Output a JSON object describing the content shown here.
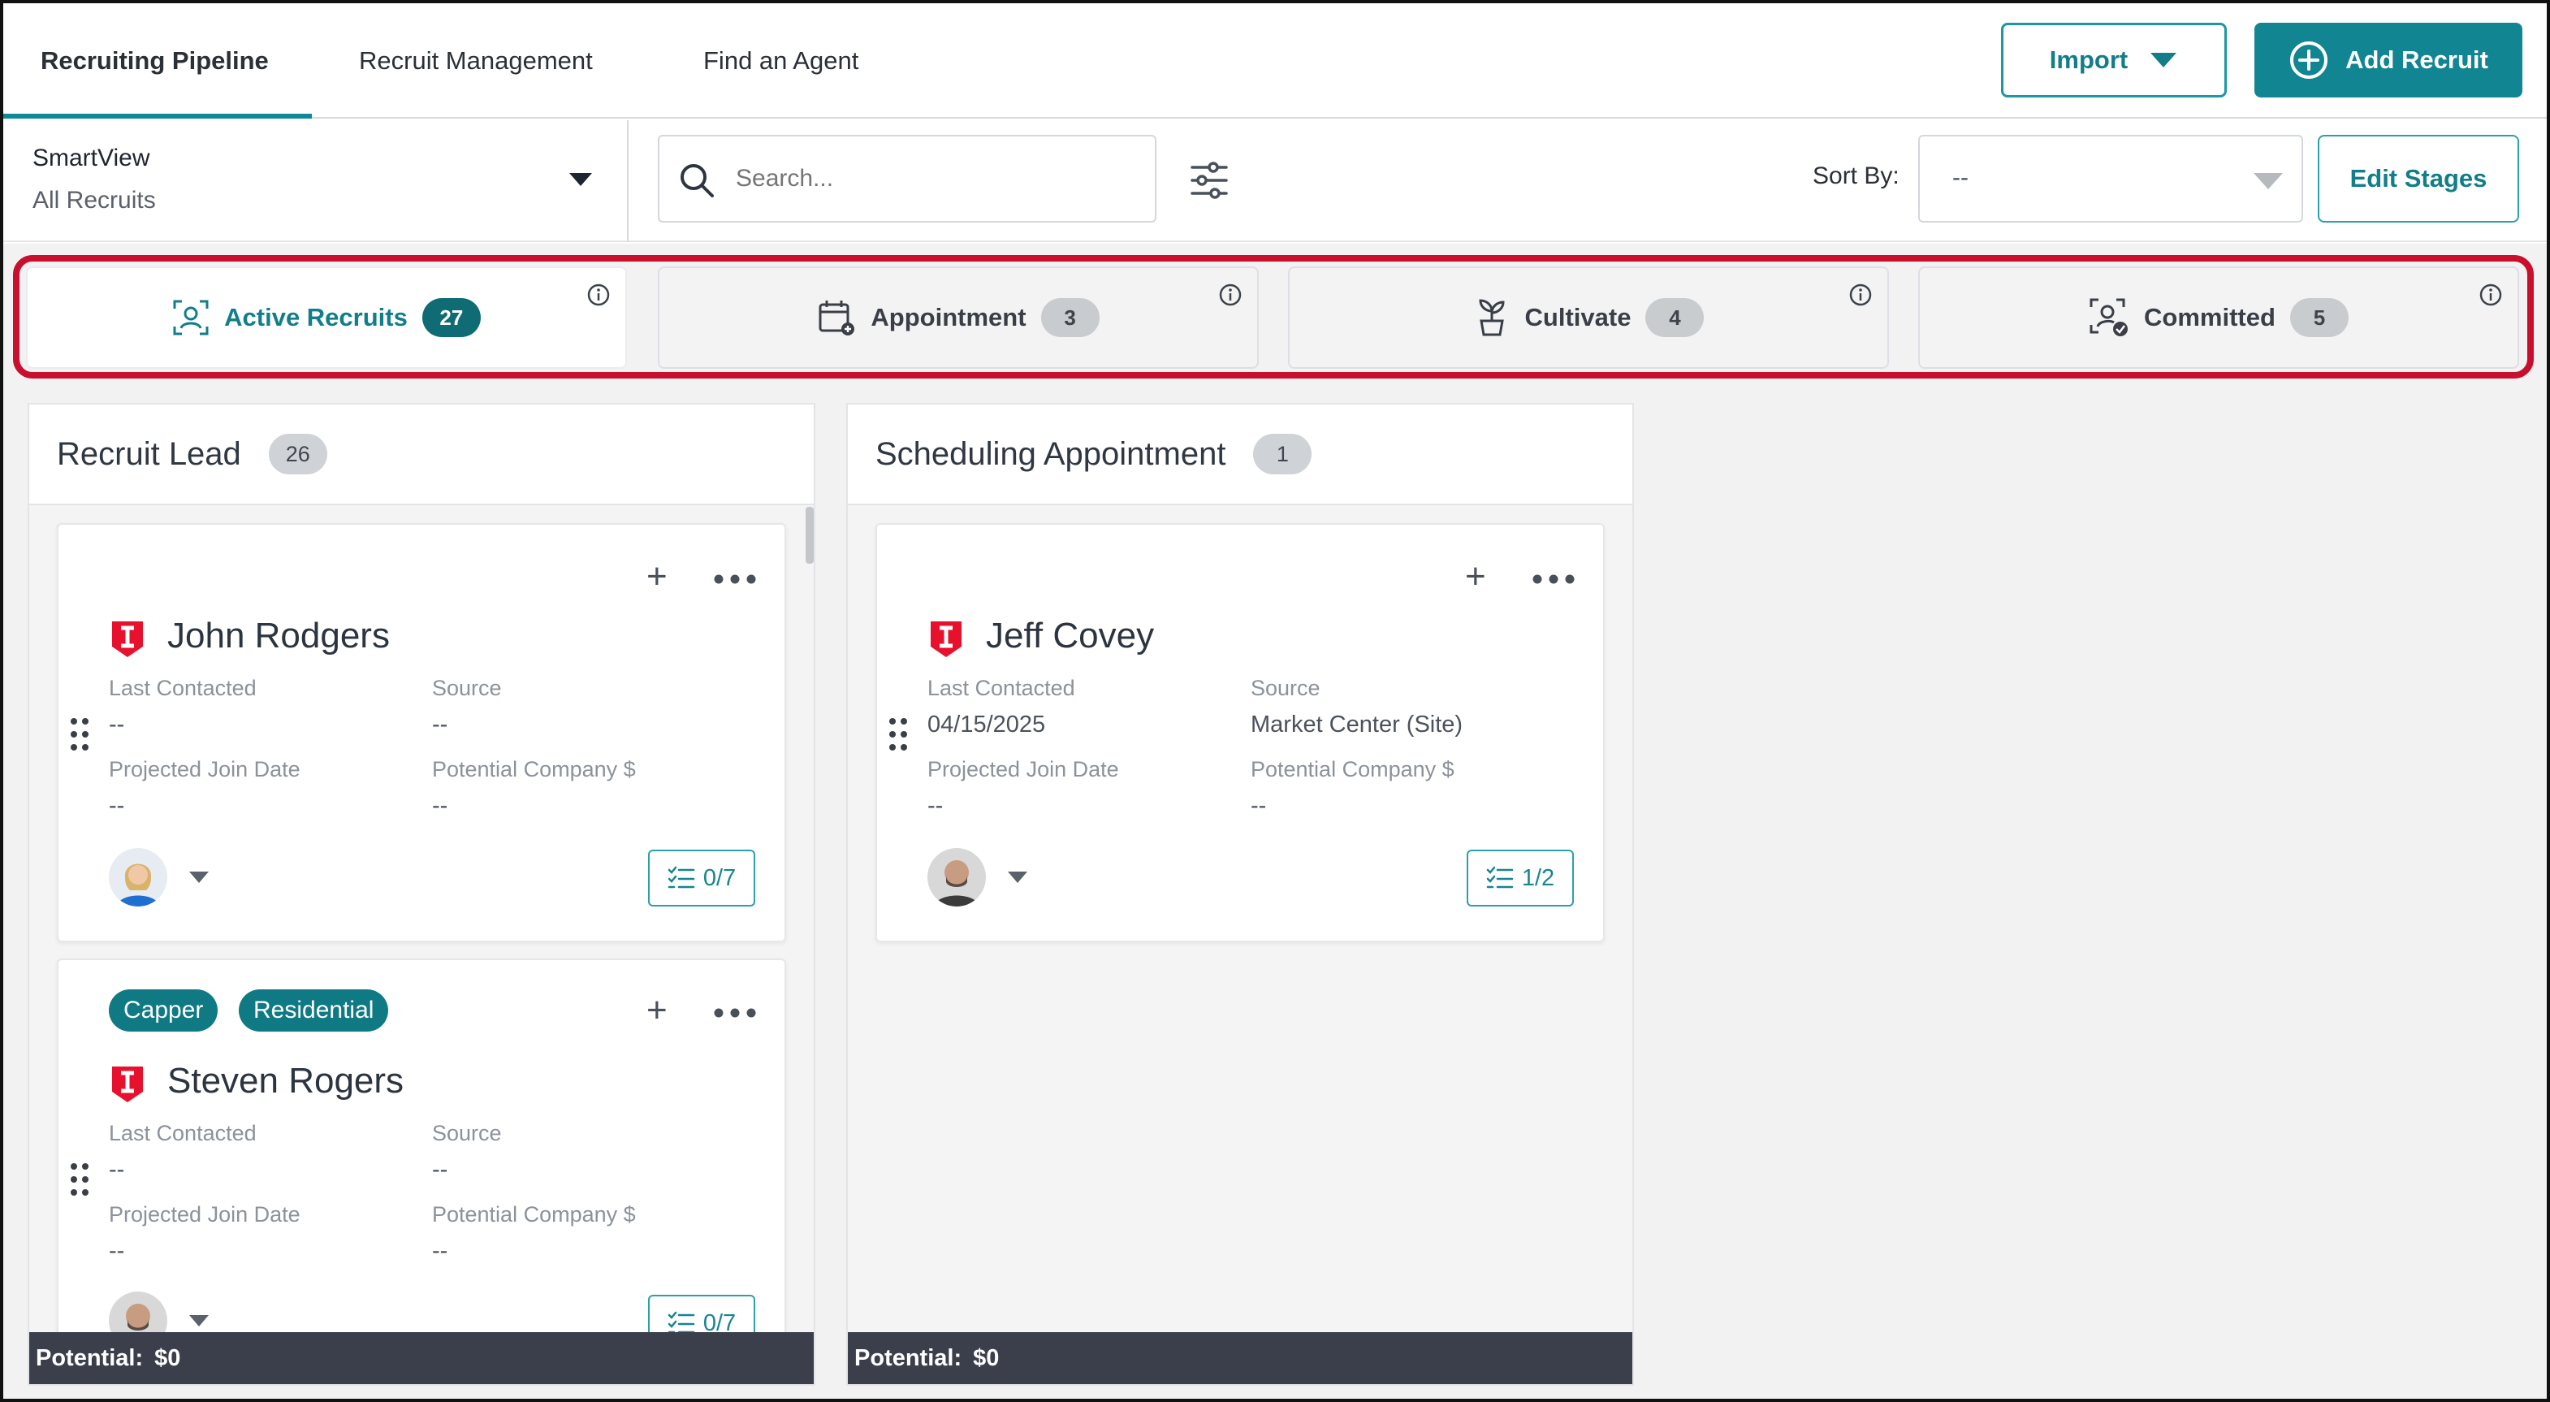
{
  "nav": {
    "tabs": [
      {
        "label": "Recruiting Pipeline",
        "active": true
      },
      {
        "label": "Recruit Management",
        "active": false
      },
      {
        "label": "Find an Agent",
        "active": false
      }
    ],
    "import_label": "Import",
    "add_label": "Add Recruit"
  },
  "toolbar": {
    "smartview_label": "SmartView",
    "smartview_value": "All Recruits",
    "search_placeholder": "Search...",
    "sort_label": "Sort By:",
    "sort_value": "--",
    "edit_stages_label": "Edit Stages"
  },
  "stages": [
    {
      "label": "Active Recruits",
      "count": "27",
      "icon": "users-icon",
      "active": true
    },
    {
      "label": "Appointment",
      "count": "3",
      "icon": "calendar-icon",
      "active": false
    },
    {
      "label": "Cultivate",
      "count": "4",
      "icon": "plant-icon",
      "active": false
    },
    {
      "label": "Committed",
      "count": "5",
      "icon": "user-check-icon",
      "active": false
    }
  ],
  "columns": [
    {
      "title": "Recruit Lead",
      "count": "26",
      "footer_label": "Potential:",
      "footer_value": "$0",
      "cards": [
        {
          "name": "John Rodgers",
          "tags": [],
          "last_contacted_label": "Last Contacted",
          "last_contacted": "--",
          "source_label": "Source",
          "source": "--",
          "join_label": "Projected Join Date",
          "join": "--",
          "company_label": "Potential Company $",
          "company": "--",
          "tasks": "0/7",
          "avatar_icon": "avatar-woman-icon"
        },
        {
          "name": "Steven Rogers",
          "tags": [
            "Capper",
            "Residential"
          ],
          "last_contacted_label": "Last Contacted",
          "last_contacted": "--",
          "source_label": "Source",
          "source": "--",
          "join_label": "Projected Join Date",
          "join": "--",
          "company_label": "Potential Company $",
          "company": "--",
          "tasks": "0/7",
          "avatar_icon": "avatar-man-icon"
        }
      ]
    },
    {
      "title": "Scheduling Appointment",
      "count": "1",
      "footer_label": "Potential:",
      "footer_value": "$0",
      "cards": [
        {
          "name": "Jeff Covey",
          "tags": [],
          "last_contacted_label": "Last Contacted",
          "last_contacted": "04/15/2025",
          "source_label": "Source",
          "source": "Market Center (Site)",
          "join_label": "Projected Join Date",
          "join": "--",
          "company_label": "Potential Company $",
          "company": "--",
          "tasks": "1/2",
          "avatar_icon": "avatar-man-icon"
        }
      ]
    }
  ],
  "colors": {
    "accent": "#128593",
    "highlight": "#c8102e",
    "footer": "#3a3f4b",
    "brand_shield": "#e8112d"
  }
}
